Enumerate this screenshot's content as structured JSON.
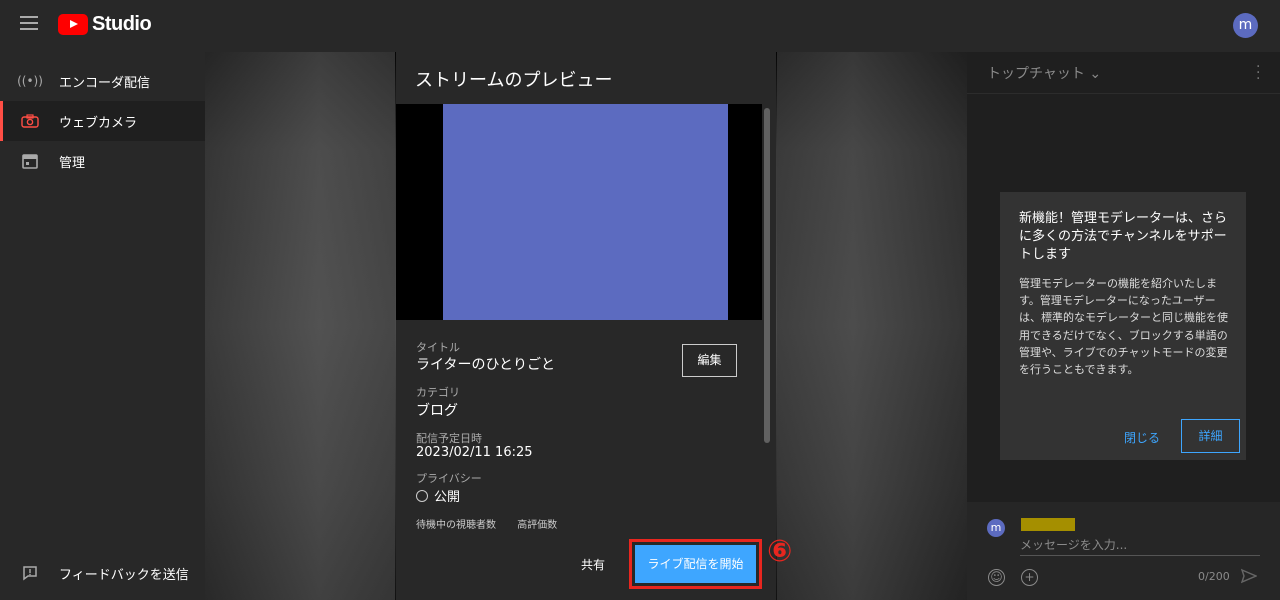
{
  "header": {
    "logo_text": "Studio",
    "avatar_letter": "m"
  },
  "sidebar": {
    "items": [
      {
        "label": "エンコーダ配信",
        "icon": "broadcast-icon"
      },
      {
        "label": "ウェブカメラ",
        "icon": "camera-icon"
      },
      {
        "label": "管理",
        "icon": "calendar-icon"
      }
    ],
    "feedback_label": "フィードバックを送信"
  },
  "dialog": {
    "title": "ストリームのプレビュー",
    "title_label": "タイトル",
    "title_value": "ライターのひとりごと",
    "edit_label": "編集",
    "category_label": "カテゴリ",
    "category_value": "ブログ",
    "schedule_label": "配信予定日時",
    "schedule_value": "2023/02/11 16:25",
    "privacy_label": "プライバシー",
    "privacy_value": "公開",
    "stat_waiting": "待機中の視聴者数",
    "stat_rating": "高評価数",
    "share_label": "共有",
    "start_label": "ライブ配信を開始",
    "step_number": "⑥"
  },
  "chat": {
    "title": "トップチャット",
    "card": {
      "title": "新機能！管理モデレーターは、さらに多くの方法でチャンネルをサポートします",
      "body": "管理モデレーターの機能を紹介いたします。管理モデレーターになったユーザーは、標準的なモデレーターと同じ機能を使用できるだけでなく、ブロックする単語の管理や、ライブでのチャットモードの変更を行うこともできます。",
      "close_label": "閉じる",
      "detail_label": "詳細"
    },
    "avatar_letter": "m",
    "input_placeholder": "メッセージを入力...",
    "char_count": "0/200"
  },
  "colors": {
    "accent": "#3ea6ff",
    "brand_red": "#ff0000",
    "highlight": "#e8261f",
    "avatar": "#5c6bc0"
  }
}
